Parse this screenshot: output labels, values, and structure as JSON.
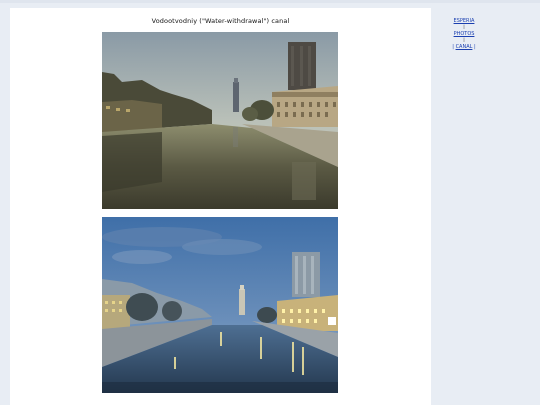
{
  "page": {
    "title": "Vodootvodniy (\"Water-withdrawal\") canal"
  },
  "sidenav": {
    "items": [
      {
        "label": "ESPERIA"
      },
      {
        "label": "PHOTOS"
      },
      {
        "label": "CANAL"
      }
    ],
    "separator": "|",
    "current_prefix": "|",
    "current_suffix": "|"
  }
}
